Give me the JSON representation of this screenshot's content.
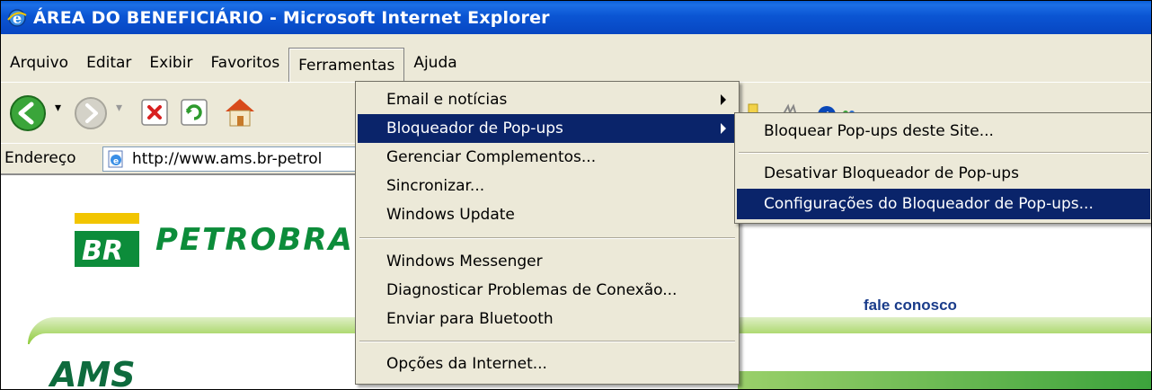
{
  "window": {
    "title": "ÁREA DO BENEFICIÁRIO - Microsoft Internet Explorer"
  },
  "menubar": {
    "items": [
      "Arquivo",
      "Editar",
      "Exibir",
      "Favoritos",
      "Ferramentas",
      "Ajuda"
    ],
    "active": "Ferramentas"
  },
  "address": {
    "label": "Endereço",
    "url": "http://www.ams.br-petrol"
  },
  "tools_menu": {
    "items": [
      {
        "label": "Email e notícias",
        "submenu": true
      },
      {
        "label": "Bloqueador de Pop-ups",
        "submenu": true,
        "highlighted": true
      },
      {
        "label": "Gerenciar Complementos..."
      },
      {
        "label": "Sincronizar..."
      },
      {
        "label": "Windows Update"
      },
      {
        "label": "Windows Messenger"
      },
      {
        "label": "Diagnosticar Problemas de Conexão..."
      },
      {
        "label": "Enviar para Bluetooth"
      },
      {
        "label": "Opções da Internet..."
      }
    ]
  },
  "popup_submenu": {
    "items": [
      {
        "label": "Bloquear Pop-ups deste Site..."
      },
      {
        "label": "Desativar Bloqueador de Pop-ups"
      },
      {
        "label": "Configurações do Bloqueador de Pop-ups...",
        "highlighted": true
      }
    ]
  },
  "page": {
    "brand": "PETROBRA",
    "logo_text": "BR",
    "contact_link": "fale conosco",
    "ams_text": "AMS"
  },
  "colors": {
    "titlebar": "#0b55d3",
    "menu_bg": "#ece9d8",
    "highlight": "#0a246a",
    "brand_green": "#0c8c3a",
    "brand_yellow": "#f2c500",
    "link_blue": "#1a3c8a"
  },
  "icons": [
    "ie-logo-icon",
    "back-icon",
    "forward-icon",
    "stop-icon",
    "refresh-icon",
    "home-icon",
    "page-icon",
    "submenu-arrow-icon"
  ]
}
